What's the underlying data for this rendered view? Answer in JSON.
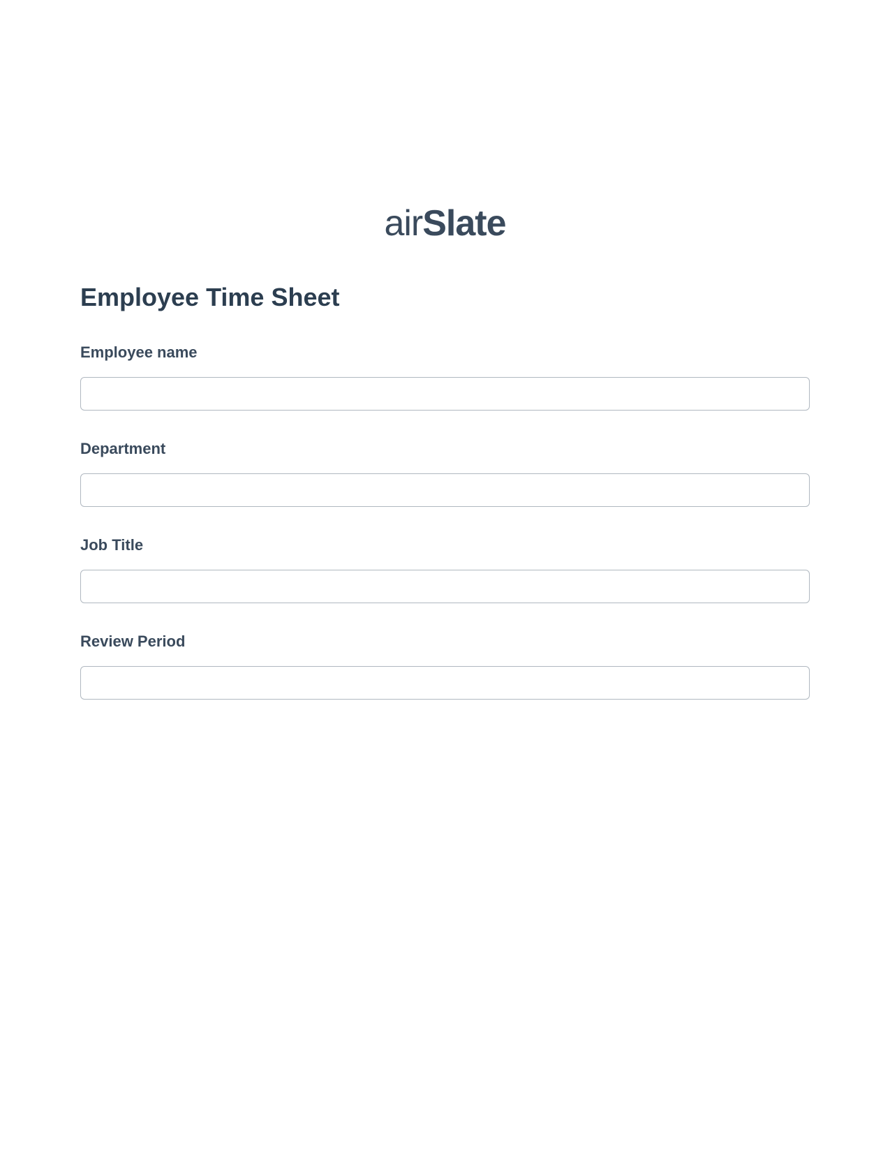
{
  "logo": {
    "prefix": "air",
    "suffix": "Slate"
  },
  "form": {
    "title": "Employee Time Sheet",
    "fields": [
      {
        "label": "Employee name",
        "value": ""
      },
      {
        "label": "Department",
        "value": ""
      },
      {
        "label": "Job Title",
        "value": ""
      },
      {
        "label": "Review Period",
        "value": ""
      }
    ]
  }
}
